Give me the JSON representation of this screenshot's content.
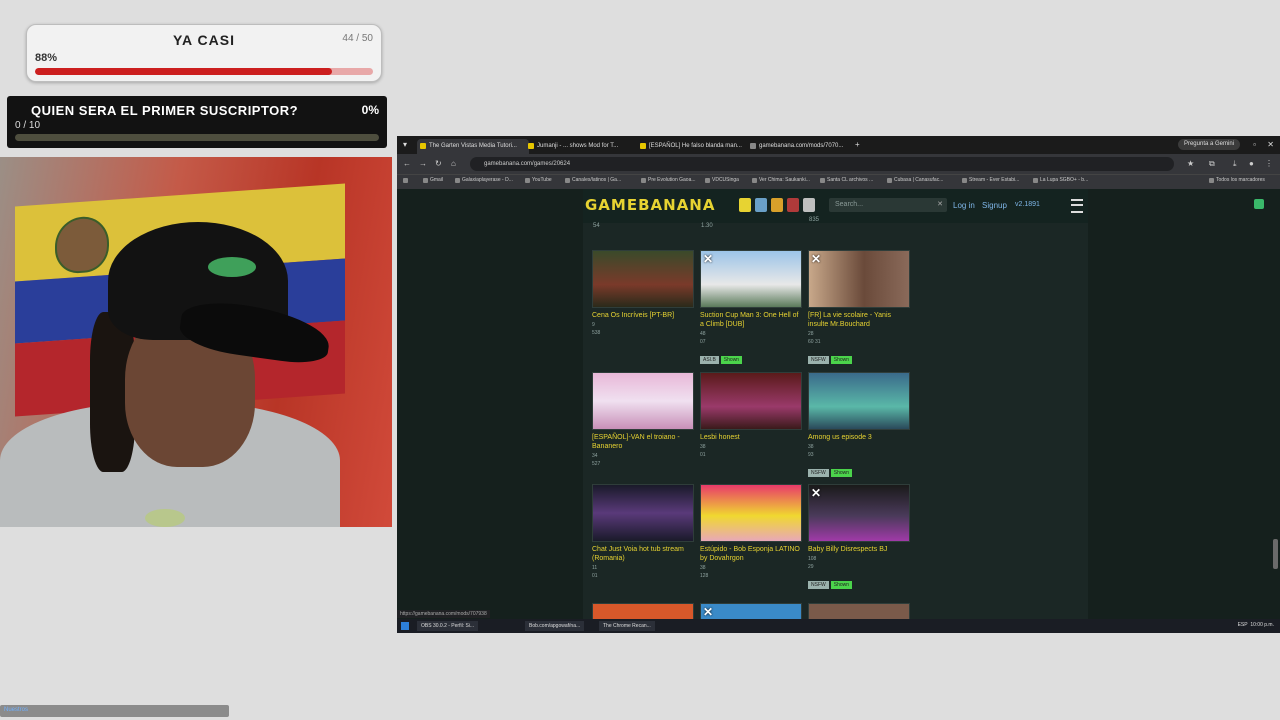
{
  "goal": {
    "title": "YA CASI",
    "count": "44 / 50",
    "percent": "88%",
    "progress": 0.88
  },
  "subgoal": {
    "title": "QUIEN SERA EL PRIMER SUSCRIPTOR?",
    "percent": "0%",
    "count": "0 / 10",
    "progress": 0.0
  },
  "browser": {
    "tabs": [
      {
        "label": "The Garten Vistas Media Tutori..."
      },
      {
        "label": "Jumanji - ... shows Mod for T..."
      },
      {
        "label": "[ESPAÑOL] He falso blanda man..."
      },
      {
        "label": "gamebanana.com/mods/7070..."
      }
    ],
    "gemini_label": "Pregunta a Gemini",
    "url": "gamebanana.com/games/20624",
    "bookmarks": [
      "Gmail",
      "Galaxiaplayerase - D...",
      "YouTube",
      "Canales/latinos | Ga...",
      "Pre Evolution Gaoa...",
      "VDCUSinga",
      "Ver Chima: Saukanki...",
      "Santa CL archivos ...",
      "Cubasa | Canasufac...",
      "Stream - Ever Estabi...",
      "La Lupa SGBO+ - b..."
    ],
    "bookmarks_right": "Todos los marcadores"
  },
  "site": {
    "logo": "GAMEBANANA",
    "search_placeholder": "Search...",
    "login": "Log in",
    "signup": "Signup",
    "user_points": "v2.1891",
    "stubs": [
      {
        "views": "54",
        "likes": "1.30",
        "comments": "835"
      }
    ],
    "cards": [
      {
        "title": "Cena Os Incríveis [PT-BR]",
        "meta1": "9",
        "meta2": "538",
        "badges": []
      },
      {
        "title": "Suction Cup Man 3: One Hell of a Climb [DUB]",
        "meta1": "48",
        "meta2": "07",
        "badges": [
          "ASI.B",
          "Shown"
        ]
      },
      {
        "title": "[FR] La vie scolaire - Yanis insulte Mr.Bouchard",
        "meta1": "28",
        "meta2": "60  31",
        "badges": [
          "NSFW",
          "Shown"
        ]
      },
      {
        "title": "[ESPAÑOL]-VAN el troiano - Bananero",
        "meta1": "34",
        "meta2": "527",
        "badges": []
      },
      {
        "title": "Lesbi honest",
        "meta1": "38",
        "meta2": "01",
        "badges": []
      },
      {
        "title": "Among us episode 3",
        "meta1": "38",
        "meta2": "93",
        "badges": [
          "NSFW",
          "Shown"
        ]
      },
      {
        "title": "Chat Just Voia hot tub stream (Romania)",
        "meta1": "11",
        "meta2": "01",
        "badges": []
      },
      {
        "title": "Estúpido - Bob Esponja LATINO by Dovahrgon",
        "meta1": "38",
        "meta2": "128",
        "badges": []
      },
      {
        "title": "Baby Billy Disrespects BJ",
        "meta1": "108",
        "meta2": "29",
        "badges": [
          "NSFW",
          "Shown"
        ]
      }
    ],
    "status_url": "https://gamebanana.com/mods/707938"
  },
  "taskbar": {
    "items": [
      "OBS 30.0.2 - Perfil: Si...",
      "Bob.com/apgowaf/na...",
      "The Chrome Recan..."
    ],
    "clock": "10:00 p.m.",
    "lang": "ESP"
  },
  "chat": {
    "label": "Nuestros"
  },
  "colors": {
    "accent_yellow": "#e7d332",
    "progress_red": "#cc1f1f",
    "badge_green": "#4bd34b",
    "link_blue": "#7fb6e8"
  }
}
